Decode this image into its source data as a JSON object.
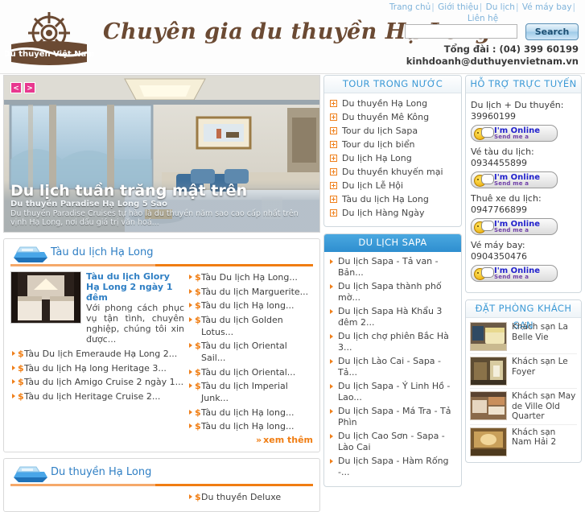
{
  "site": {
    "logo_text": "Du thuyền Việt Nam",
    "tagline": "Chuyên gia du thuyền Hạ Long"
  },
  "topnav": {
    "items": [
      "Trang chủ",
      "Giới thiệu",
      "Du lịch",
      "Vé máy bay",
      "Liên hệ"
    ],
    "separator": "|"
  },
  "search": {
    "value": "",
    "placeholder": "",
    "button_label": "Search"
  },
  "contact": {
    "hotline": "Tổng đài : (04) 399 60199",
    "email": "kinhdoanh@duthuyenvietnam.vn"
  },
  "hero": {
    "prev_label": "<",
    "next_label": ">",
    "title": "Du lịch tuần trăng mật trên",
    "subtitle": "Du thuyền Paradise Hạ Long 5 Sao",
    "description": "Du thuyền Paradise Cruises tự hào là du thuyền năm sao cao cấp nhất trên vịnh Hạ Long, nơi dấu giá trị văn hoá..."
  },
  "panel_tau": {
    "title": "Tàu du lịch Hạ Long",
    "feature": {
      "title": "Tàu du lịch Glory Hạ Long 2 ngày 1 đêm",
      "description": "Với phong cách phục vụ tận tình, chuyên nghiệp, chúng tôi xin được..."
    },
    "left_links": [
      "Tàu Du lịch Emeraude Hạ Long 2...",
      "Tàu du lịch Hạ long Heritage 3...",
      "Tàu du lịch Amigo Cruise 2 ngày 1...",
      "Tàu du lịch Heritage Cruise 2..."
    ],
    "right_links": [
      "Tàu Du lịch Hạ Long...",
      "Tàu du lịch Marguerite...",
      "Tàu du lịch Hạ long...",
      "Tàu du lịch Golden Lotus...",
      "Tàu du lịch Oriental Sail...",
      "Tàu du lịch Oriental...",
      "Tàu du lịch Imperial Junk...",
      "Tàu du lịch Hạ long...",
      "Tàu du lịch Hạ long..."
    ],
    "more_label": "xem thêm"
  },
  "panel_duthuyen": {
    "title": "Du thuyền Hạ Long",
    "right_links": [
      "Du thuyền Deluxe"
    ]
  },
  "tour_trong_nuoc": {
    "title": "TOUR TRONG NƯỚC",
    "items": [
      "Du thuyền Hạ Long",
      "Du thuyền Mê Kông",
      "Tour du lịch Sapa",
      "Tour du lịch biển",
      "Du lịch Hạ Long",
      "Du thuyền khuyến mại",
      "Du lịch Lễ Hội",
      "Tàu du lịch Hạ Long",
      "Du lịch Hàng Ngày"
    ]
  },
  "du_lich_sapa": {
    "title": "DU LỊCH SAPA",
    "items": [
      "Du lịch Sapa - Tả van - Bản...",
      "Du lịch Sapa thành phố mờ...",
      "Du lịch Sapa Hà Khẩu 3 đêm 2...",
      "Du lịch chợ phiên Bắc Hà 3...",
      "Du lịch Lào Cai - Sapa - Tả...",
      "Du lịch Sapa - Ý Linh Hồ - Lao...",
      "Du lịch Sapa - Má Tra - Tả Phìn",
      "Du lịch Cao Sơn - Sapa - Lào Cai",
      "Du lịch Sapa - Hàm Rống -..."
    ]
  },
  "ho_tro": {
    "title": "HỖ TRỢ TRỰC TUYẾN",
    "contacts": [
      {
        "label": "Du lịch + Du thuyền: 39960199"
      },
      {
        "label": "Vé tàu du lịch: 0934455899"
      },
      {
        "label": "Thuê xe du lịch: 0947766899"
      },
      {
        "label": "Vé máy bay: 0904350476"
      }
    ],
    "status_title": "I'm Online",
    "status_sub": "Send me a message"
  },
  "khach_san": {
    "title": "ĐẶT PHÒNG KHÁCH SẠN",
    "items": [
      "Khách sạn La Belle Vie",
      "Khách sạn Le Foyer",
      "Khách sạn May de Ville Old Quarter",
      "Khách sạn Nam Hải 2"
    ]
  },
  "colors": {
    "brand_brown": "#6b4a33",
    "accent_orange": "#f07d12",
    "link_blue": "#2f7fc4",
    "header_blue": "#3d9ad6",
    "sapa_blue": "#2f8fd0",
    "arrow_pink": "#e8388f"
  }
}
